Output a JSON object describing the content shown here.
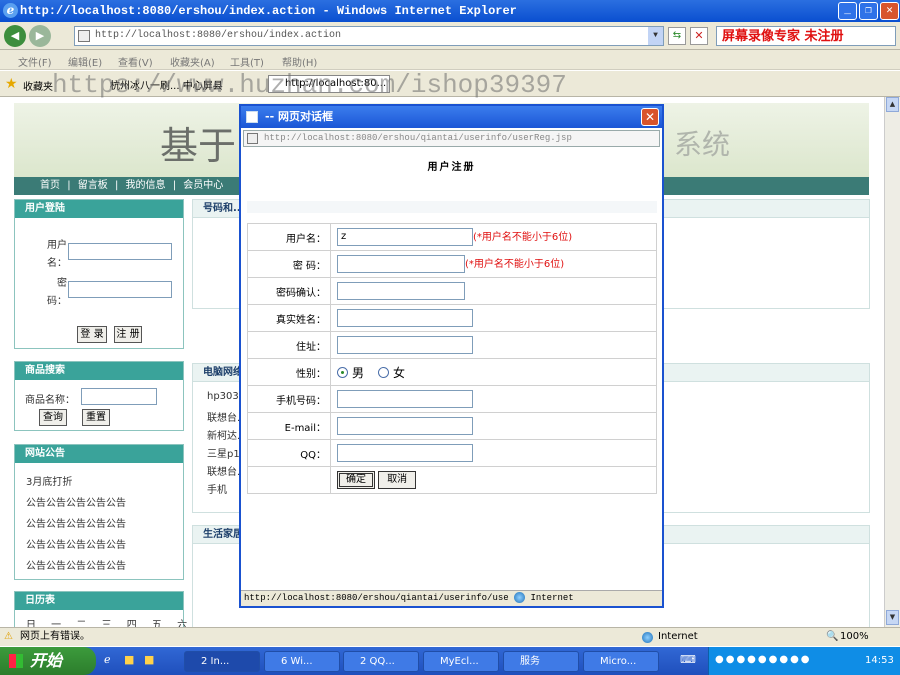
{
  "window": {
    "title": "http://localhost:8080/ershou/index.action - Windows Internet Explorer",
    "address": "http://localhost:8080/ershou/index.action",
    "watermark": "屏幕录像专家 未注册",
    "ghost_url": "https://www.huzhan.com/ishop39397"
  },
  "menu": [
    "文件(F)",
    "编辑(E)",
    "查看(V)",
    "收藏夹(A)",
    "工具(T)",
    "帮助(H)"
  ],
  "favorites": {
    "label": "收藏夹",
    "tab1": "杭州冰八一刷... 中心屏县",
    "tab2": "http://localhost:80..."
  },
  "site": {
    "banner_title": "基于",
    "banner_tail": "系统",
    "nav": [
      "首页",
      "|",
      "留言板",
      "|",
      "我的信息",
      "|",
      "会员中心"
    ],
    "login": {
      "header": "用户登陆",
      "user_label_a": "用户",
      "user_label_b": "名：",
      "pwd_label_a": "密",
      "pwd_label_b": "码：",
      "login_btn": "登 录",
      "register_btn": "注 册"
    },
    "search": {
      "header": "商品搜索",
      "name_label": "商品名称：",
      "query_btn": "查询",
      "reset_btn": "重置"
    },
    "notice": {
      "header": "网站公告",
      "items": [
        "3月底打折",
        "公告公告公告公告公告",
        "公告公告公告公告公告",
        "公告公告公告公告公告",
        "公告公告公告公告公告"
      ]
    },
    "calendar": {
      "header": "日历表",
      "days": "日 一 二 三 四 五 六"
    },
    "mid1": {
      "header": "号码和..."
    },
    "mid2": {
      "header": "电脑网络",
      "items": [
        "hp303...",
        "联想台...",
        "新柯达...",
        "三星p1...",
        "联想台...",
        "手机"
      ]
    },
    "mid3": {
      "header": "生活家居"
    }
  },
  "dialog": {
    "title": "-- 网页对话框",
    "address": "http://localhost:8080/ershou/qiantai/userinfo/userReg.jsp",
    "heading": "用户注册",
    "username_label": "用户名：",
    "username_value": "z",
    "username_hint": "(*用户名不能小于6位)",
    "password_label": "密 码：",
    "password_hint": "(*用户名不能小于6位)",
    "confirm_label": "密码确认：",
    "realname_label": "真实姓名：",
    "address_label": "住址：",
    "gender_label": "性别：",
    "gender_male": "男",
    "gender_female": "女",
    "phone_label": "手机号码：",
    "email_label": "E-mail：",
    "qq_label": "QQ：",
    "ok_btn": "确定",
    "cancel_btn": "取消",
    "status_url": "http://localhost:8080/ershou/qiantai/userinfo/use",
    "status_zone": "Internet"
  },
  "statusbar": {
    "error": "网页上有错误。",
    "zone": "Internet",
    "zoom": "100%"
  },
  "taskbar": {
    "start": "开始",
    "items": [
      "2 In...",
      "6 Wi...",
      "2 QQ...",
      "MyEcl...",
      "服务",
      "Micro..."
    ],
    "time": "14:53"
  }
}
